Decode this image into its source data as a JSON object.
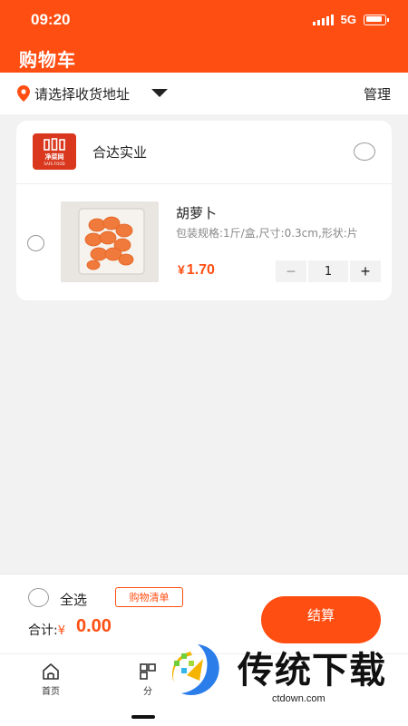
{
  "status": {
    "time": "09:20",
    "network": "5G"
  },
  "header": {
    "title": "购物车"
  },
  "address": {
    "placeholder": "请选择收货地址",
    "manage_label": "管理"
  },
  "store": {
    "name": "合达实业",
    "logo_text": "净菜网",
    "logo_subtext": "SAFE FOOD"
  },
  "item": {
    "name": "胡萝卜",
    "spec": "包装规格:1斤/盒,尺寸:0.3cm,形状:片",
    "currency": "¥",
    "price": "1.70",
    "quantity": "1",
    "minus": "−",
    "plus": "+"
  },
  "footer": {
    "select_all": "全选",
    "list_button": "购物清单",
    "total_label": "合计:",
    "currency": "¥",
    "total_value": "0.00",
    "checkout": "结算"
  },
  "tabs": [
    {
      "label": "首页",
      "icon": "home-icon"
    },
    {
      "label": "分",
      "icon": "category-icon"
    }
  ],
  "watermark": {
    "brand": "传统下载",
    "url": "ctdown.com"
  },
  "colors": {
    "accent": "#ff4e12",
    "background": "#f2f2f2"
  }
}
